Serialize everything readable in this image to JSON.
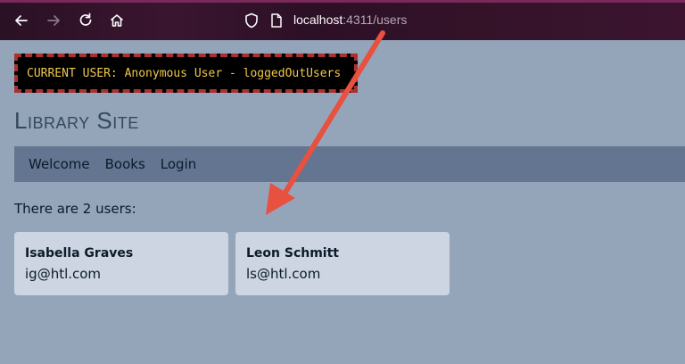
{
  "browser": {
    "url_host": "localhost",
    "url_rest": ":4311/users",
    "icons": [
      "back-icon",
      "forward-icon",
      "reload-icon",
      "home-icon",
      "shield-icon",
      "page-icon"
    ]
  },
  "banner": {
    "text": "CURRENT USER: Anonymous User - loggedOutUsers"
  },
  "site": {
    "title": "Library Site"
  },
  "nav": {
    "items": [
      {
        "label": "Welcome"
      },
      {
        "label": "Books"
      },
      {
        "label": "Login"
      }
    ]
  },
  "users": {
    "count_text": "There are 2 users:",
    "list": [
      {
        "name": "Isabella Graves",
        "email": "ig@htl.com"
      },
      {
        "name": "Leon Schmitt",
        "email": "ls@htl.com"
      }
    ]
  },
  "colors": {
    "page_bg": "#94a5ba",
    "nav_bg": "#637590",
    "card_bg": "#ccd5e1",
    "arrow": "#e8503f",
    "banner_text": "#f0c84a"
  }
}
